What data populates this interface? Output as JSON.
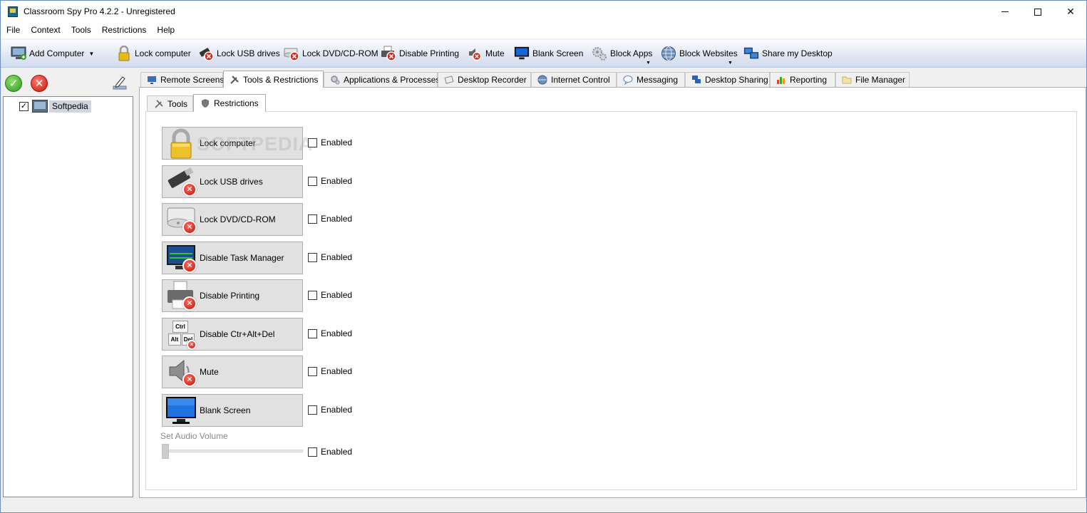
{
  "window": {
    "title": "Classroom Spy Pro 4.2.2 - Unregistered"
  },
  "menu": [
    "File",
    "Context",
    "Tools",
    "Restrictions",
    "Help"
  ],
  "toolbar": {
    "add_computer": "Add Computer",
    "lock_computer": "Lock computer",
    "lock_usb": "Lock USB drives",
    "lock_dvd": "Lock DVD/CD-ROM",
    "disable_printing": "Disable Printing",
    "mute": "Mute",
    "blank_screen": "Blank Screen",
    "block_apps": "Block Apps",
    "block_websites": "Block Websites",
    "share_desktop": "Share my Desktop"
  },
  "tree": {
    "computer": "Softpedia",
    "checked": true
  },
  "tabs": [
    "Remote Screens",
    "Tools & Restrictions",
    "Applications & Processes",
    "Desktop Recorder",
    "Internet Control",
    "Messaging",
    "Desktop Sharing",
    "Reporting",
    "File Manager"
  ],
  "active_tab": "Tools & Restrictions",
  "subtabs": [
    "Tools",
    "Restrictions"
  ],
  "active_subtab": "Restrictions",
  "watermark": "SOFTPEDIA",
  "restrictions": [
    {
      "label": "Lock computer",
      "icon": "padlock-icon",
      "enabled_label": "Enabled",
      "enabled": false
    },
    {
      "label": "Lock USB drives",
      "icon": "usb-drive-icon",
      "enabled_label": "Enabled",
      "enabled": false
    },
    {
      "label": "Lock DVD/CD-ROM",
      "icon": "dvd-drive-icon",
      "enabled_label": "Enabled",
      "enabled": false
    },
    {
      "label": "Disable Task Manager",
      "icon": "task-manager-icon",
      "enabled_label": "Enabled",
      "enabled": false
    },
    {
      "label": "Disable Printing",
      "icon": "printer-icon",
      "enabled_label": "Enabled",
      "enabled": false
    },
    {
      "label": "Disable Ctr+Alt+Del",
      "icon": "keyboard-keys-icon",
      "enabled_label": "Enabled",
      "enabled": false
    },
    {
      "label": "Mute",
      "icon": "speaker-icon",
      "enabled_label": "Enabled",
      "enabled": false
    },
    {
      "label": "Blank Screen",
      "icon": "monitor-icon",
      "enabled_label": "Enabled",
      "enabled": false
    }
  ],
  "ctrl_keys": {
    "ctrl": "Ctrl",
    "alt": "Alt",
    "del": "Del"
  },
  "audio": {
    "label": "Set Audio Volume",
    "enabled_label": "Enabled",
    "enabled": false,
    "level": 0
  }
}
